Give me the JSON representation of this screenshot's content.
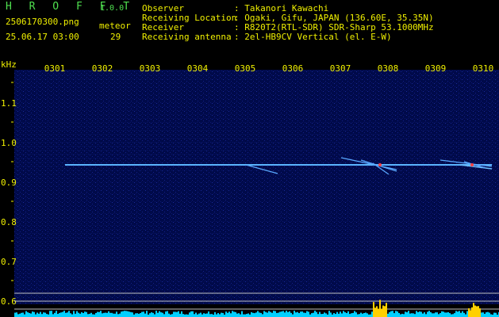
{
  "app": {
    "title": "H R O F F T",
    "version": "1.0.0"
  },
  "file": {
    "name": "2506170300.png",
    "datetime": "25.06.17 03:00"
  },
  "counter": {
    "label": "meteor",
    "value": "29"
  },
  "info": [
    {
      "key": "Observer",
      "value": ": Takanori Kawachi"
    },
    {
      "key": "Receiving Location",
      "value": ": Ogaki, Gifu, JAPAN (136.60E, 35.35N)"
    },
    {
      "key": "Receiver",
      "value": ": R820T2(RTL-SDR) SDR-Sharp 53.1000MHz"
    },
    {
      "key": "Receiving antenna",
      "value": ": 2el-HB9CV Vertical (el. E-W)"
    }
  ],
  "axis": {
    "unit": "kHz",
    "y_ticks": [
      "1.1",
      "1.0",
      "0.9",
      "0.8",
      "0.7",
      "0.6"
    ],
    "x_ticks": [
      "0301",
      "0302",
      "0303",
      "0304",
      "0305",
      "0306",
      "0307",
      "0308",
      "0309",
      "0310"
    ]
  },
  "colors": {
    "background": "#000000",
    "text": "#f0f000",
    "title": "#4fe04f",
    "plot_bg": "#000a55",
    "signal": "#5ab4ff",
    "bars": "#00d0ff",
    "peak": "#ffd000"
  }
}
